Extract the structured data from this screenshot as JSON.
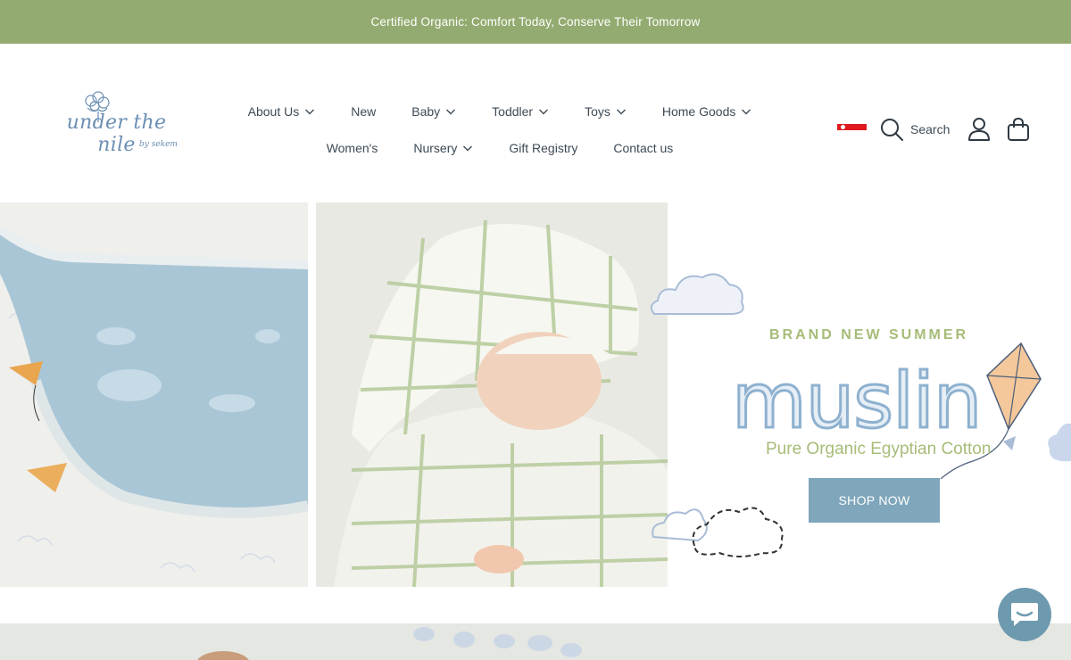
{
  "announcement": {
    "text": "Certified Organic: Comfort Today, Conserve Their Tomorrow"
  },
  "logo": {
    "name": "under the nile",
    "sub": "by sekem"
  },
  "nav": {
    "row1": [
      {
        "label": "About Us",
        "dropdown": true
      },
      {
        "label": "New",
        "dropdown": false
      },
      {
        "label": "Baby",
        "dropdown": true
      },
      {
        "label": "Toddler",
        "dropdown": true
      },
      {
        "label": "Toys",
        "dropdown": true
      },
      {
        "label": "Home Goods",
        "dropdown": true
      }
    ],
    "row2": [
      {
        "label": "Women's",
        "dropdown": false
      },
      {
        "label": "Nursery",
        "dropdown": true
      },
      {
        "label": "Gift Registry",
        "dropdown": false
      },
      {
        "label": "Contact us",
        "dropdown": false
      }
    ]
  },
  "utils": {
    "search_label": "Search",
    "icons": [
      "singapore-flag-icon",
      "search-icon",
      "account-icon",
      "cart-icon"
    ]
  },
  "hero": {
    "eyebrow": "BRAND NEW SUMMER",
    "headline": "muslin",
    "tagline": "Pure Organic Egyptian Cotton",
    "cta": "SHOP NOW"
  },
  "colors": {
    "announcement_bg": "#93ab70",
    "accent_green": "#a6bc78",
    "accent_blue": "#7fa6bb",
    "text": "#3d4a55"
  }
}
